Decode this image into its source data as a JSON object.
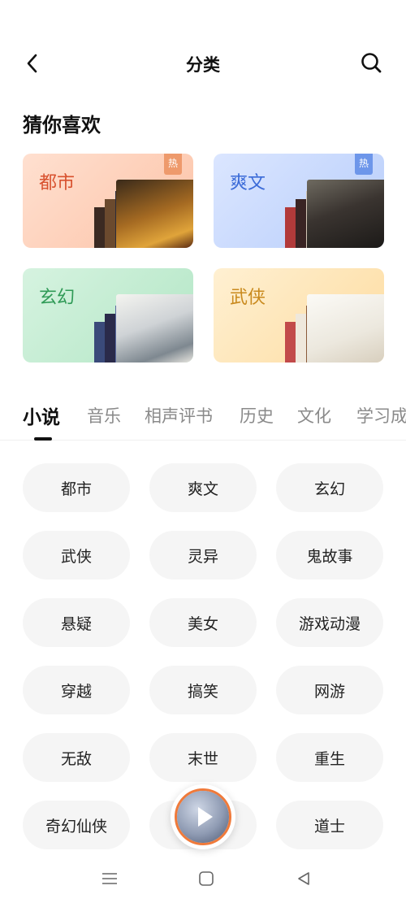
{
  "header": {
    "title": "分类",
    "back_icon": "chevron-left-icon",
    "search_icon": "search-icon"
  },
  "guess": {
    "title": "猜你喜欢",
    "cards": [
      {
        "label": "都市",
        "hot": "热",
        "color": "#d8512e"
      },
      {
        "label": "爽文",
        "hot": "热",
        "color": "#3b6bd8"
      },
      {
        "label": "玄幻",
        "hot": "",
        "color": "#2f9a56"
      },
      {
        "label": "武侠",
        "hot": "",
        "color": "#c98a1e"
      }
    ]
  },
  "tabs": [
    "小说",
    "音乐",
    "相声评书",
    "历史",
    "文化",
    "学习成"
  ],
  "active_tab": "小说",
  "categories": [
    "都市",
    "爽文",
    "玄幻",
    "武侠",
    "灵异",
    "鬼故事",
    "悬疑",
    "美女",
    "游戏动漫",
    "穿越",
    "搞笑",
    "网游",
    "无敌",
    "末世",
    "重生",
    "奇幻仙侠",
    "",
    "道士"
  ],
  "player": {
    "icon": "play-icon",
    "accent": "#f07a3a"
  },
  "system_nav": {
    "menu_icon": "menu-icon",
    "home_icon": "home-square-icon",
    "back_icon": "back-triangle-icon"
  }
}
